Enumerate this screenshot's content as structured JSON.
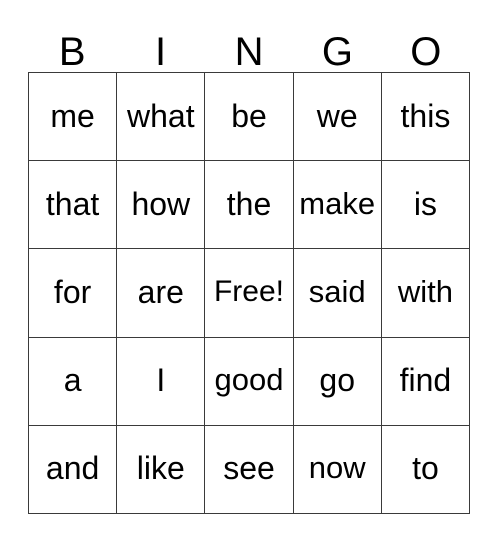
{
  "card": {
    "type": "bingo-card",
    "background_color": "#ffffff",
    "text_color": "#000000",
    "grid_line_color": "#3a3a3a"
  },
  "header": {
    "letters": [
      "B",
      "I",
      "N",
      "G",
      "O"
    ]
  },
  "grid": {
    "columns": 5,
    "rows": 5,
    "free_space": {
      "row": 2,
      "column": 2,
      "label": "Free!"
    },
    "cells": [
      [
        {
          "text": "me"
        },
        {
          "text": "what"
        },
        {
          "text": "be"
        },
        {
          "text": "we"
        },
        {
          "text": "this"
        }
      ],
      [
        {
          "text": "that"
        },
        {
          "text": "how"
        },
        {
          "text": "the"
        },
        {
          "text": "make"
        },
        {
          "text": "is"
        }
      ],
      [
        {
          "text": "for"
        },
        {
          "text": "are"
        },
        {
          "text": "Free!"
        },
        {
          "text": "said"
        },
        {
          "text": "with"
        }
      ],
      [
        {
          "text": "a"
        },
        {
          "text": "I"
        },
        {
          "text": "good"
        },
        {
          "text": "go"
        },
        {
          "text": "find"
        }
      ],
      [
        {
          "text": "and"
        },
        {
          "text": "like"
        },
        {
          "text": "see"
        },
        {
          "text": "now"
        },
        {
          "text": "to"
        }
      ]
    ]
  }
}
